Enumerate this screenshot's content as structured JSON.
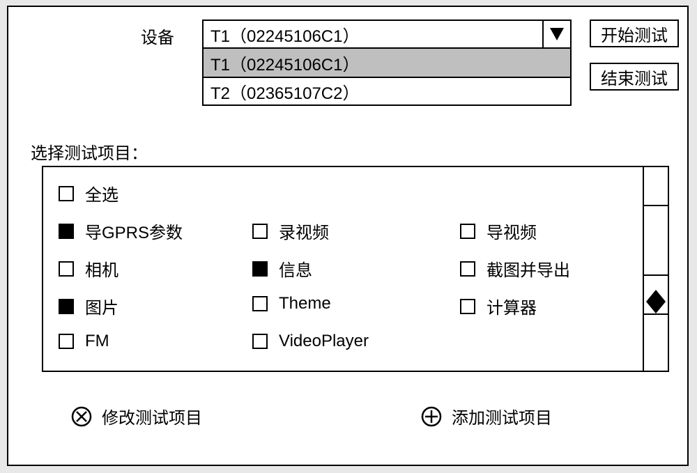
{
  "device": {
    "label": "设备",
    "selected": "T1（02245106C1）",
    "options": [
      {
        "label": "T1（02245106C1）",
        "highlighted": true
      },
      {
        "label": "T2（02365107C2）",
        "highlighted": false
      }
    ]
  },
  "buttons": {
    "start": "开始测试",
    "end": "结束测试"
  },
  "section_title": "选择测试项目：",
  "items": {
    "select_all": {
      "label": "全选",
      "checked": false
    },
    "list": [
      {
        "label": "导GPRS参数",
        "checked": true,
        "col": 0,
        "row": 1
      },
      {
        "label": "相机",
        "checked": false,
        "col": 0,
        "row": 2
      },
      {
        "label": "图片",
        "checked": true,
        "col": 0,
        "row": 3
      },
      {
        "label": "FM",
        "checked": false,
        "col": 0,
        "row": 4
      },
      {
        "label": "录视频",
        "checked": false,
        "col": 1,
        "row": 1
      },
      {
        "label": "信息",
        "checked": true,
        "col": 1,
        "row": 2
      },
      {
        "label": "Theme",
        "checked": false,
        "col": 1,
        "row": 3
      },
      {
        "label": "VideoPlayer",
        "checked": false,
        "col": 1,
        "row": 4
      },
      {
        "label": "导视频",
        "checked": false,
        "col": 2,
        "row": 1
      },
      {
        "label": "截图并导出",
        "checked": false,
        "col": 2,
        "row": 2
      },
      {
        "label": "计算器",
        "checked": false,
        "col": 2,
        "row": 3
      }
    ]
  },
  "actions": {
    "modify": "修改测试项目",
    "add": "添加测试项目"
  }
}
